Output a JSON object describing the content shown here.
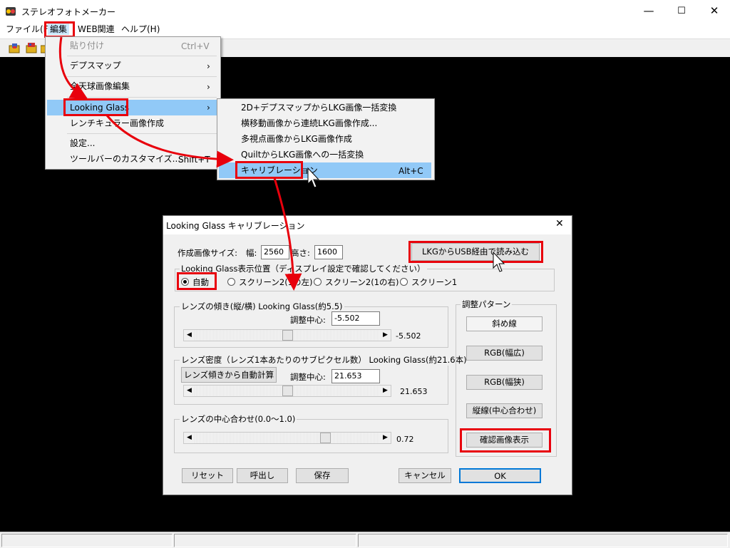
{
  "window": {
    "title": "ステレオフォトメーカー",
    "controls": {
      "minimize": "—",
      "maximize": "☐",
      "close": "✕"
    }
  },
  "menubar": [
    "ファイル(F)",
    "編集",
    "WEB関連",
    "ヘルプ(H)"
  ],
  "edit_menu": {
    "items": [
      {
        "label": "貼り付け",
        "accel": "Ctrl+V",
        "disabled": true
      },
      {
        "label": "デプスマップ",
        "submenu": true
      },
      {
        "label": "全天球画像編集",
        "submenu": true
      },
      {
        "label": "Looking Glass",
        "submenu": true,
        "highlighted": true
      },
      {
        "label": "レンチキュラー画像作成"
      },
      {
        "label": "設定..."
      },
      {
        "label": "ツールバーのカスタマイズ...",
        "accel": "Shift+T"
      }
    ]
  },
  "lg_submenu": {
    "items": [
      {
        "label": "2D+デプスマップからLKG画像一括変換"
      },
      {
        "label": "横移動画像から連続LKG画像作成..."
      },
      {
        "label": "多視点画像からLKG画像作成"
      },
      {
        "label": "QuiltからLKG画像への一括変換"
      },
      {
        "label": "キャリブレーション",
        "accel": "Alt+C",
        "highlighted": true
      }
    ]
  },
  "dialog": {
    "title": "Looking Glass キャリブレーション",
    "close": "✕",
    "size_label": "作成画像サイズ:",
    "width_label": "幅:",
    "width_value": "2560",
    "height_label": "高さ:",
    "height_value": "1600",
    "usb_button": "LKGからUSB経由で読み込む",
    "position_group": "Looking Glass表示位置（ディスプレイ設定で確認してください）",
    "radios": [
      "自動",
      "スクリーン2(1の左)",
      "スクリーン2(1の右)",
      "スクリーン1"
    ],
    "radio_selected": "自動",
    "tilt_group": "レンズの傾き(縦/横) Looking Glass(約5.5)",
    "tilt_center_label": "調整中心:",
    "tilt_center_value": "-5.502",
    "tilt_value": "-5.502",
    "tilt_slider_fraction": 0.5,
    "density_group": "レンズ密度（レンズ1本あたりのサブピクセル数） Looking Glass(約21.6本)",
    "auto_calc_button": "レンズ傾きから自動計算",
    "density_center_label": "調整中心:",
    "density_center_value": "21.653",
    "density_value": "21.653",
    "density_slider_fraction": 0.5,
    "center_group": "レンズの中心合わせ(0.0〜1.0)",
    "center_value": "0.72",
    "center_slider_fraction": 0.72,
    "pattern_group": "調整パターン",
    "pattern_buttons": [
      "斜め線",
      "RGB(幅広)",
      "RGB(幅狭)",
      "縦線(中心合わせ)",
      "確認画像表示"
    ],
    "buttons": {
      "reset": "リセット",
      "recall": "呼出し",
      "save": "保存",
      "cancel": "キャンセル",
      "ok": "OK"
    }
  },
  "colors": {
    "highlight": "#91c9f7",
    "annotation_red": "#e8000c"
  }
}
